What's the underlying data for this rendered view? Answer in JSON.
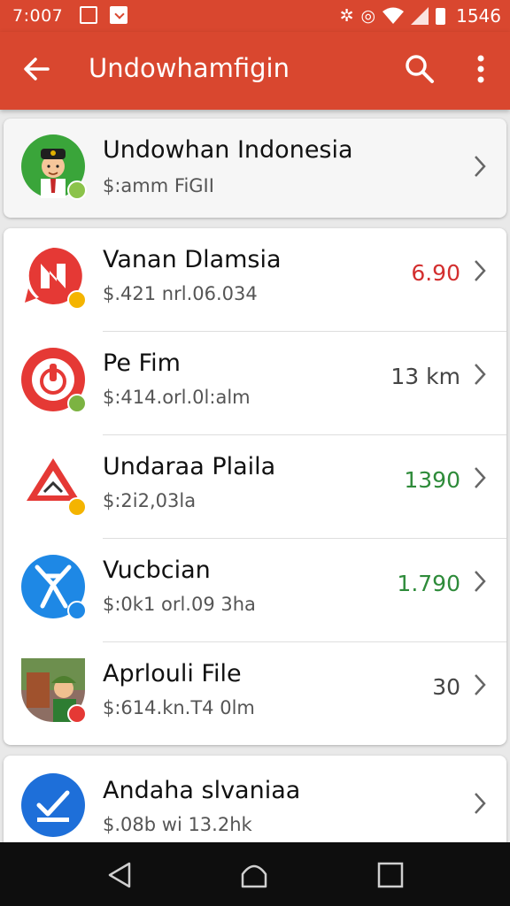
{
  "status_bar": {
    "time_left": "7:007",
    "clock": "1546",
    "icons": [
      "image-icon",
      "download-icon",
      "vibrate-icon",
      "alarm-icon",
      "wifi-icon",
      "signal-icon",
      "battery-icon"
    ]
  },
  "app_bar": {
    "title": "Undowhamfigin",
    "back_icon": "back-arrow-icon",
    "search_icon": "search-icon",
    "menu_icon": "more-vert-icon"
  },
  "top_item": {
    "title": "Undowhan Indonesia",
    "subtitle": "$:amm FiGII",
    "badge_color": "#8bc34a"
  },
  "list_items": [
    {
      "title": "Vanan Dlamsia",
      "subtitle": "$.421 nrl.06.034",
      "value": "6.90",
      "value_color": "#d32f2f",
      "icon": "brand-n-icon",
      "badge_color": "#f4b400"
    },
    {
      "title": "Pe Fim",
      "subtitle": "$:414.orl.0l:alm",
      "value": "13 km",
      "value_color": "#444444",
      "icon": "power-icon",
      "badge_color": "#7cb342"
    },
    {
      "title": "Undaraa Plaila",
      "subtitle": "$:2i2,03la",
      "value": "1390",
      "value_color": "#2e8b3a",
      "icon": "warning-triangle-icon",
      "badge_color": "#f4b400"
    },
    {
      "title": "Vucbcian",
      "subtitle": "$:0k1 orl.09 3ha",
      "value": "1.790",
      "value_color": "#2e8b3a",
      "icon": "figure-icon",
      "badge_color": "#1e88e5"
    },
    {
      "title": "Aprlouli File",
      "subtitle": "$:614.kn.T4 0lm",
      "value": "30",
      "value_color": "#444444",
      "icon": "photo-avatar-icon",
      "badge_color": "#e53935"
    }
  ],
  "bottom_item": {
    "title": "Andaha slvaniaa",
    "subtitle": "$.08b wi 13.2hk",
    "icon": "checklist-icon"
  },
  "nav_bar": {
    "icons": [
      "nav-back-icon",
      "nav-home-icon",
      "nav-recents-icon"
    ]
  }
}
